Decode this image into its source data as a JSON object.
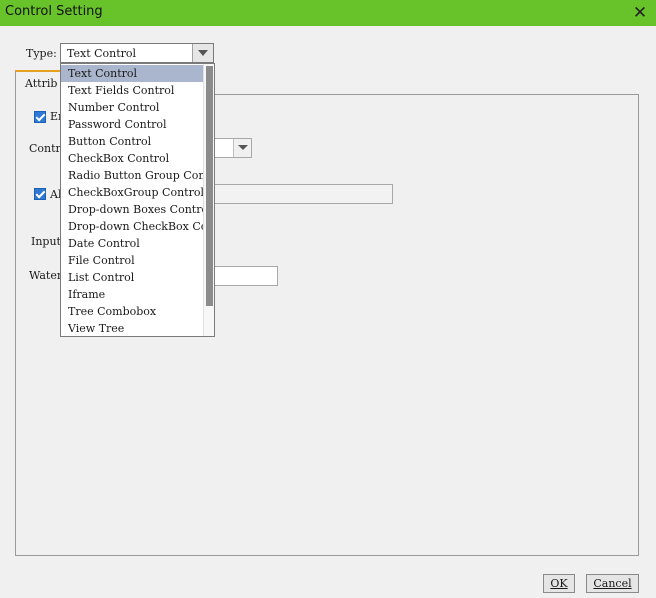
{
  "window": {
    "title": "Control Setting",
    "close_icon": "close-icon"
  },
  "type_selector": {
    "label": "Type:",
    "value": "Text Control"
  },
  "tab": {
    "label": "Attrib"
  },
  "form": {
    "row1_label": "Er",
    "row2_label": "Contr",
    "row3_label": "Al",
    "row4_label": "Input",
    "row5_label": "Waterl"
  },
  "dropdown": {
    "selected_index": 0,
    "options": [
      "Text Control",
      "Text Fields Control",
      "Number Control",
      "Password Control",
      "Button Control",
      "CheckBox Control",
      "Radio Button Group Cont",
      "CheckBoxGroup Control",
      "Drop-down Boxes Control",
      "Drop-down CheckBox Cont",
      "Date Control",
      "File Control",
      "List Control",
      "Iframe",
      "Tree Combobox",
      "View Tree"
    ]
  },
  "footer": {
    "ok_label": "OK",
    "cancel_label": "Cancel"
  },
  "colors": {
    "titlebar": "#68c32a",
    "selected_option": "#a9b6cd",
    "checkbox": "#2f79d6",
    "tab_accent": "#e6a020"
  }
}
